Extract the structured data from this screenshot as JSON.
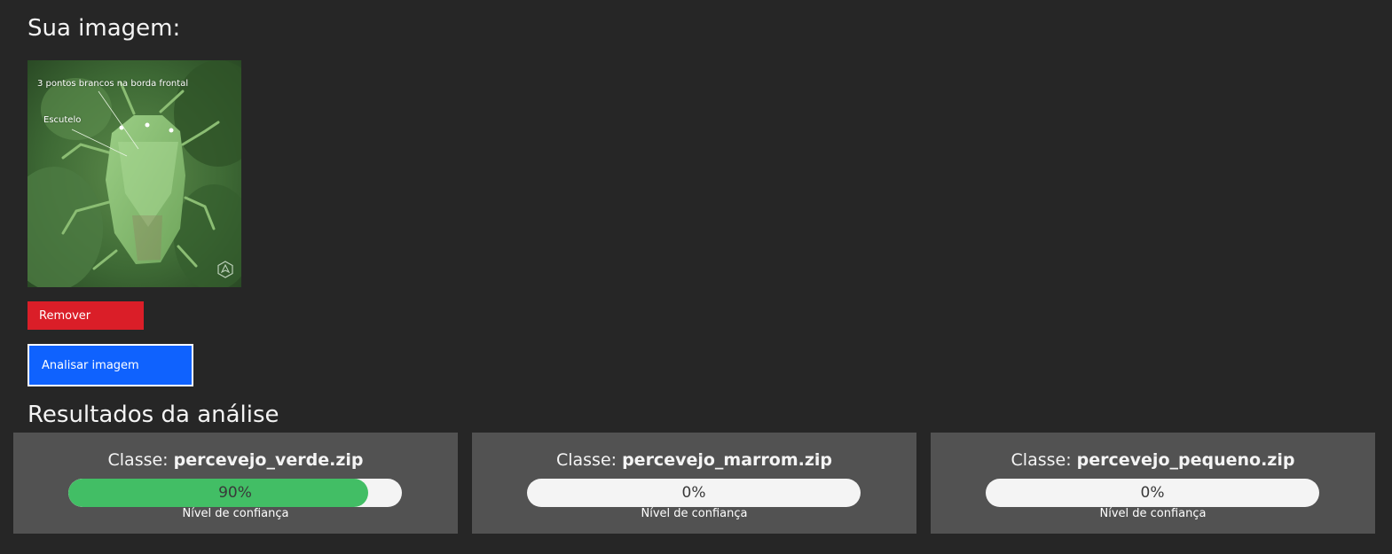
{
  "upload": {
    "heading": "Sua imagem:",
    "image": {
      "annotation_1": "3 pontos brancos na borda frontal",
      "annotation_2": "Escutelo"
    },
    "remove_label": "Remover",
    "analyze_label": "Analisar imagem"
  },
  "results": {
    "heading": "Resultados da análise",
    "class_prefix": "Classe:",
    "confidence_label": "Nível de confiança",
    "colors": {
      "fill": "#42be65",
      "track": "#f4f4f4"
    },
    "items": [
      {
        "class_name": "percevejo_verde.zip",
        "confidence": 90,
        "confidence_text": "90%"
      },
      {
        "class_name": "percevejo_marrom.zip",
        "confidence": 0,
        "confidence_text": "0%"
      },
      {
        "class_name": "percevejo_pequeno.zip",
        "confidence": 0,
        "confidence_text": "0%"
      }
    ]
  },
  "colors": {
    "background": "#262626",
    "remove_button": "#da1e28",
    "analyze_button": "#0f62fe",
    "card": "#525252"
  }
}
